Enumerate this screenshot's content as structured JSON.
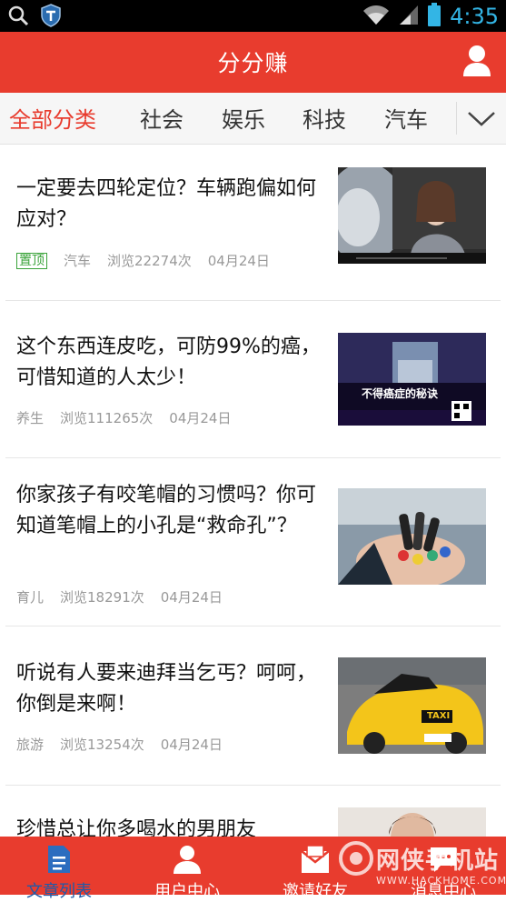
{
  "status_bar": {
    "time": "4:35"
  },
  "app_bar": {
    "title": "分分赚"
  },
  "tabs": [
    {
      "label": "全部分类"
    },
    {
      "label": "社会"
    },
    {
      "label": "娱乐"
    },
    {
      "label": "科技"
    },
    {
      "label": "汽车"
    }
  ],
  "articles": [
    {
      "title": "一定要去四轮定位？车辆跑偏如何应对？",
      "tag": "置顶",
      "category": "汽车",
      "views": "浏览22274次",
      "date": "04月24日",
      "thumb_caption": ""
    },
    {
      "title": "这个东西连皮吃，可防99%的癌，可惜知道的人太少！",
      "category": "养生",
      "views": "浏览111265次",
      "date": "04月24日",
      "thumb_caption": "不得癌症的秘诀"
    },
    {
      "title": "你家孩子有咬笔帽的习惯吗？你可知道笔帽上的小孔是“救命孔”？",
      "category": "育儿",
      "views": "浏览18291次",
      "date": "04月24日"
    },
    {
      "title": "听说有人要来迪拜当乞丐？呵呵，你倒是来啊！",
      "category": "旅游",
      "views": "浏览13254次",
      "date": "04月24日",
      "thumb_caption": "TAXI"
    },
    {
      "title": "珍惜总让你多喝水的男朋友"
    }
  ],
  "bottom_nav": [
    {
      "label": "文章列表"
    },
    {
      "label": "用户中心"
    },
    {
      "label": "邀请好友"
    },
    {
      "label": "消息中心"
    }
  ],
  "watermark": {
    "brand": "网侠手机站",
    "url": "WWW.HACKHOME.COM"
  },
  "colors": {
    "brand_red": "#e83c2e",
    "tag_green": "#3aa33a",
    "clock_blue": "#33b5e5"
  },
  "icons": [
    "search-icon",
    "shield-icon",
    "wifi-icon",
    "signal-icon",
    "battery-icon",
    "user-icon",
    "chevron-down-icon",
    "article-list-icon",
    "user-center-icon",
    "invite-friends-icon",
    "message-center-icon"
  ]
}
